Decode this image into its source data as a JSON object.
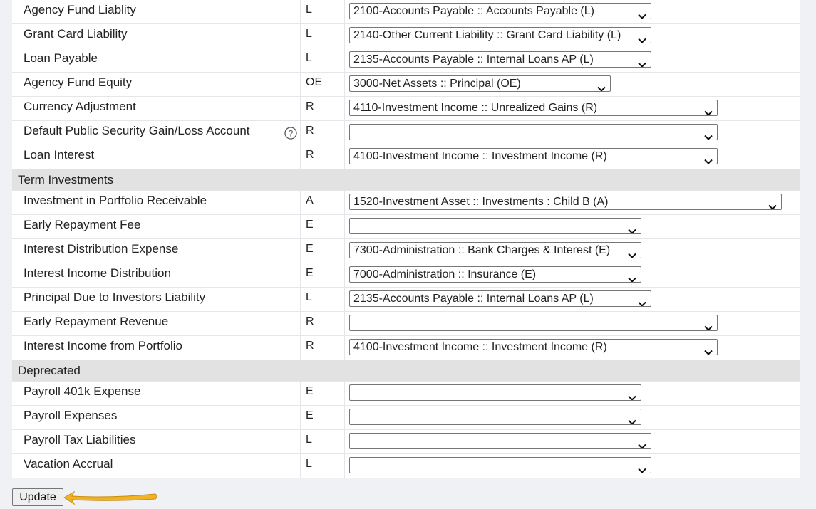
{
  "rows": [
    {
      "kind": "item",
      "name": "Agency Fund Liablity",
      "type": "L",
      "account": "2100-Accounts Payable :: Accounts Payable (L)",
      "select_width": 424
    },
    {
      "kind": "item",
      "name": "Grant Card Liability",
      "type": "L",
      "account": "2140-Other Current Liability :: Grant Card Liability (L)",
      "select_width": 424
    },
    {
      "kind": "item",
      "name": "Loan Payable",
      "type": "L",
      "account": "2135-Accounts Payable :: Internal Loans AP (L)",
      "select_width": 424
    },
    {
      "kind": "item",
      "name": "Agency Fund Equity",
      "type": "OE",
      "account": "3000-Net Assets :: Principal (OE)",
      "select_width": 367
    },
    {
      "kind": "item",
      "name": "Currency Adjustment",
      "type": "R",
      "account": "4110-Investment Income :: Unrealized Gains (R)",
      "select_width": 517
    },
    {
      "kind": "item",
      "name": "Default Public Security Gain/Loss Account",
      "type": "R",
      "account": "",
      "select_width": 517,
      "help": true,
      "help_glyph": "?"
    },
    {
      "kind": "item",
      "name": "Loan Interest",
      "type": "R",
      "account": "4100-Investment Income :: Investment Income (R)",
      "select_width": 517
    },
    {
      "kind": "section",
      "label": "Term Investments"
    },
    {
      "kind": "item",
      "name": "Investment in Portfolio Receivable",
      "type": "A",
      "account": "1520-Investment Asset :: Investments : Child B (A)",
      "select_width": 607
    },
    {
      "kind": "item",
      "name": "Early Repayment Fee",
      "type": "E",
      "account": "",
      "select_width": 410
    },
    {
      "kind": "item",
      "name": "Interest Distribution Expense",
      "type": "E",
      "account": "7300-Administration :: Bank Charges & Interest (E)",
      "select_width": 410
    },
    {
      "kind": "item",
      "name": "Interest Income Distribution",
      "type": "E",
      "account": "7000-Administration :: Insurance (E)",
      "select_width": 410
    },
    {
      "kind": "item",
      "name": "Principal Due to Investors Liability",
      "type": "L",
      "account": "2135-Accounts Payable :: Internal Loans AP (L)",
      "select_width": 424
    },
    {
      "kind": "item",
      "name": "Early Repayment Revenue",
      "type": "R",
      "account": "",
      "select_width": 517
    },
    {
      "kind": "item",
      "name": "Interest Income from Portfolio",
      "type": "R",
      "account": "4100-Investment Income :: Investment Income (R)",
      "select_width": 517
    },
    {
      "kind": "section",
      "label": "Deprecated"
    },
    {
      "kind": "item",
      "name": "Payroll 401k Expense",
      "type": "E",
      "account": "",
      "select_width": 410
    },
    {
      "kind": "item",
      "name": "Payroll Expenses",
      "type": "E",
      "account": "",
      "select_width": 410
    },
    {
      "kind": "item",
      "name": "Payroll Tax Liabilities",
      "type": "L",
      "account": "",
      "select_width": 424
    },
    {
      "kind": "item",
      "name": "Vacation Accrual",
      "type": "L",
      "account": "",
      "select_width": 424
    }
  ],
  "update_label": "Update",
  "colors": {
    "arrow": "#f0b323",
    "section_bg": "#e2e2e2",
    "page_bg": "#eff1f5"
  }
}
